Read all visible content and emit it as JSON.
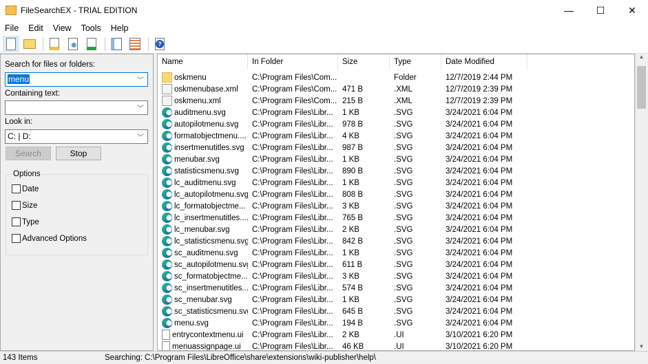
{
  "window": {
    "title": "FileSearchEX - TRIAL EDITION",
    "minimize": "—",
    "maximize": "☐",
    "close": "✕"
  },
  "menu": [
    "File",
    "Edit",
    "View",
    "Tools",
    "Help"
  ],
  "toolbar": {
    "icons": [
      "new-document-icon",
      "open-folder-icon",
      "find-in-folder-icon",
      "search-document-icon",
      "export-icon",
      "panel-icon",
      "details-view-icon",
      "help-icon"
    ]
  },
  "search": {
    "label": "Search for files or folders:",
    "value": "menu",
    "containing_label": "Containing text:",
    "containing_value": "",
    "lookin_label": "Look in:",
    "lookin_value": "C: | D:",
    "search_btn": "Search",
    "stop_btn": "Stop"
  },
  "options": {
    "title": "Options",
    "items": [
      "Date",
      "Size",
      "Type",
      "Advanced Options"
    ]
  },
  "columns": [
    "Name",
    "In Folder",
    "Size",
    "Type",
    "Date Modified"
  ],
  "rows": [
    [
      "folder",
      "oskmenu",
      "C:\\Program Files\\Com...",
      "",
      "Folder",
      "12/7/2019 2:44 PM"
    ],
    [
      "xml",
      "oskmenubase.xml",
      "C:\\Program Files\\Com...",
      "471 B",
      ".XML",
      "12/7/2019 2:39 PM"
    ],
    [
      "xml",
      "oskmenu.xml",
      "C:\\Program Files\\Com...",
      "215 B",
      ".XML",
      "12/7/2019 2:39 PM"
    ],
    [
      "svg",
      "auditmenu.svg",
      "C:\\Program Files\\Libr...",
      "1 KB",
      ".SVG",
      "3/24/2021 6:04 PM"
    ],
    [
      "svg",
      "autopilotmenu.svg",
      "C:\\Program Files\\Libr...",
      "978 B",
      ".SVG",
      "3/24/2021 6:04 PM"
    ],
    [
      "svg",
      "formatobjectmenu....",
      "C:\\Program Files\\Libr...",
      "4 KB",
      ".SVG",
      "3/24/2021 6:04 PM"
    ],
    [
      "svg",
      "insertmenutitles.svg",
      "C:\\Program Files\\Libr...",
      "987 B",
      ".SVG",
      "3/24/2021 6:04 PM"
    ],
    [
      "svg",
      "menubar.svg",
      "C:\\Program Files\\Libr...",
      "1 KB",
      ".SVG",
      "3/24/2021 6:04 PM"
    ],
    [
      "svg",
      "statisticsmenu.svg",
      "C:\\Program Files\\Libr...",
      "890 B",
      ".SVG",
      "3/24/2021 6:04 PM"
    ],
    [
      "svg",
      "lc_auditmenu.svg",
      "C:\\Program Files\\Libr...",
      "1 KB",
      ".SVG",
      "3/24/2021 6:04 PM"
    ],
    [
      "svg",
      "lc_autopilotmenu.svg",
      "C:\\Program Files\\Libr...",
      "808 B",
      ".SVG",
      "3/24/2021 6:04 PM"
    ],
    [
      "svg",
      "lc_formatobjectme...",
      "C:\\Program Files\\Libr...",
      "3 KB",
      ".SVG",
      "3/24/2021 6:04 PM"
    ],
    [
      "svg",
      "lc_insertmenutitles....",
      "C:\\Program Files\\Libr...",
      "765 B",
      ".SVG",
      "3/24/2021 6:04 PM"
    ],
    [
      "svg",
      "lc_menubar.svg",
      "C:\\Program Files\\Libr...",
      "2 KB",
      ".SVG",
      "3/24/2021 6:04 PM"
    ],
    [
      "svg",
      "lc_statisticsmenu.svg",
      "C:\\Program Files\\Libr...",
      "842 B",
      ".SVG",
      "3/24/2021 6:04 PM"
    ],
    [
      "svg",
      "sc_auditmenu.svg",
      "C:\\Program Files\\Libr...",
      "1 KB",
      ".SVG",
      "3/24/2021 6:04 PM"
    ],
    [
      "svg",
      "sc_autopilotmenu.svg",
      "C:\\Program Files\\Libr...",
      "611 B",
      ".SVG",
      "3/24/2021 6:04 PM"
    ],
    [
      "svg",
      "sc_formatobjectme...",
      "C:\\Program Files\\Libr...",
      "3 KB",
      ".SVG",
      "3/24/2021 6:04 PM"
    ],
    [
      "svg",
      "sc_insertmenutitles...",
      "C:\\Program Files\\Libr...",
      "574 B",
      ".SVG",
      "3/24/2021 6:04 PM"
    ],
    [
      "svg",
      "sc_menubar.svg",
      "C:\\Program Files\\Libr...",
      "1 KB",
      ".SVG",
      "3/24/2021 6:04 PM"
    ],
    [
      "svg",
      "sc_statisticsmenu.svg",
      "C:\\Program Files\\Libr...",
      "645 B",
      ".SVG",
      "3/24/2021 6:04 PM"
    ],
    [
      "svg",
      "menu.svg",
      "C:\\Program Files\\Libr...",
      "194 B",
      ".SVG",
      "3/24/2021 6:04 PM"
    ],
    [
      "ui",
      "entrycontextmenu.ui",
      "C:\\Program Files\\Libr...",
      "2 KB",
      ".UI",
      "3/10/2021 6:20 PM"
    ],
    [
      "ui",
      "menuassignpage.ui",
      "C:\\Program Files\\Libr...",
      "46 KB",
      ".UI",
      "3/10/2021 6:20 PM"
    ]
  ],
  "status": {
    "count": "143 Items",
    "searching_label": "Searching:",
    "path": "C:\\Program Files\\LibreOffice\\share\\extensions\\wiki-publisher\\help\\"
  }
}
